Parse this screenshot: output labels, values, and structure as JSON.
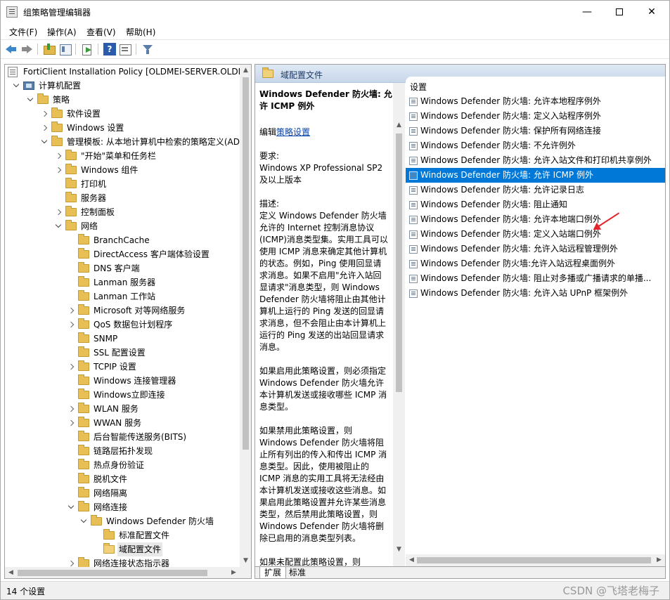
{
  "window": {
    "title": "组策略管理编辑器",
    "minimize": "—",
    "close": "✕"
  },
  "menu": [
    "文件(F)",
    "操作(A)",
    "查看(V)",
    "帮助(H)"
  ],
  "toolbar": {
    "help_glyph": "?"
  },
  "tree": [
    {
      "label": "FortiClient Installation Policy [OLDMEI-SERVER.OLDME",
      "icon": "policy-icon",
      "exp": "none",
      "level": 0
    },
    {
      "label": "计算机配置",
      "icon": "computer-icon",
      "exp": "open",
      "level": 1
    },
    {
      "label": "策略",
      "icon": "folder-icon",
      "exp": "open",
      "level": 2
    },
    {
      "label": "软件设置",
      "icon": "folder-icon",
      "exp": "closed",
      "level": 3
    },
    {
      "label": "Windows 设置",
      "icon": "folder-icon",
      "exp": "closed",
      "level": 3
    },
    {
      "label": "管理模板: 从本地计算机中检索的策略定义(ADM",
      "icon": "folder-icon",
      "exp": "open",
      "level": 3
    },
    {
      "label": "\"开始\"菜单和任务栏",
      "icon": "folder-icon",
      "exp": "closed",
      "level": 4
    },
    {
      "label": "Windows 组件",
      "icon": "folder-icon",
      "exp": "closed",
      "level": 4
    },
    {
      "label": "打印机",
      "icon": "folder-icon",
      "exp": "none",
      "level": 4
    },
    {
      "label": "服务器",
      "icon": "folder-icon",
      "exp": "none",
      "level": 4
    },
    {
      "label": "控制面板",
      "icon": "folder-icon",
      "exp": "closed",
      "level": 4
    },
    {
      "label": "网络",
      "icon": "folder-icon",
      "exp": "open",
      "level": 4
    },
    {
      "label": "BranchCache",
      "icon": "folder-icon",
      "exp": "none",
      "level": 5
    },
    {
      "label": "DirectAccess 客户端体验设置",
      "icon": "folder-icon",
      "exp": "none",
      "level": 5
    },
    {
      "label": "DNS 客户端",
      "icon": "folder-icon",
      "exp": "none",
      "level": 5
    },
    {
      "label": "Lanman 服务器",
      "icon": "folder-icon",
      "exp": "none",
      "level": 5
    },
    {
      "label": "Lanman 工作站",
      "icon": "folder-icon",
      "exp": "none",
      "level": 5
    },
    {
      "label": "Microsoft 对等网络服务",
      "icon": "folder-icon",
      "exp": "closed",
      "level": 5
    },
    {
      "label": "QoS 数据包计划程序",
      "icon": "folder-icon",
      "exp": "closed",
      "level": 5
    },
    {
      "label": "SNMP",
      "icon": "folder-icon",
      "exp": "none",
      "level": 5
    },
    {
      "label": "SSL 配置设置",
      "icon": "folder-icon",
      "exp": "none",
      "level": 5
    },
    {
      "label": "TCPIP 设置",
      "icon": "folder-icon",
      "exp": "closed",
      "level": 5
    },
    {
      "label": "Windows 连接管理器",
      "icon": "folder-icon",
      "exp": "none",
      "level": 5
    },
    {
      "label": "Windows立即连接",
      "icon": "folder-icon",
      "exp": "none",
      "level": 5
    },
    {
      "label": "WLAN 服务",
      "icon": "folder-icon",
      "exp": "closed",
      "level": 5
    },
    {
      "label": "WWAN 服务",
      "icon": "folder-icon",
      "exp": "closed",
      "level": 5
    },
    {
      "label": "后台智能传送服务(BITS)",
      "icon": "folder-icon",
      "exp": "none",
      "level": 5
    },
    {
      "label": "链路层拓扑发现",
      "icon": "folder-icon",
      "exp": "none",
      "level": 5
    },
    {
      "label": "热点身份验证",
      "icon": "folder-icon",
      "exp": "none",
      "level": 5
    },
    {
      "label": "脱机文件",
      "icon": "folder-icon",
      "exp": "none",
      "level": 5
    },
    {
      "label": "网络隔离",
      "icon": "folder-icon",
      "exp": "none",
      "level": 5
    },
    {
      "label": "网络连接",
      "icon": "folder-icon",
      "exp": "open",
      "level": 5
    },
    {
      "label": "Windows Defender 防火墙",
      "icon": "folder-icon",
      "exp": "open",
      "level": 6
    },
    {
      "label": "标准配置文件",
      "icon": "folder-icon",
      "exp": "none",
      "level": 7
    },
    {
      "label": "域配置文件",
      "icon": "folder-icon",
      "exp": "none",
      "level": 7,
      "selected": true
    },
    {
      "label": "网络连接状态指示器",
      "icon": "folder-icon",
      "exp": "closed",
      "level": 5
    }
  ],
  "mid": {
    "header": "域配置文件",
    "policy_title": "Windows Defender 防火墙: 允许 ICMP 例外",
    "edit_prefix": "编辑",
    "edit_link": "策略设置",
    "requirements_label": "要求:",
    "requirements": "Windows XP Professional SP2 及以上版本",
    "description_label": "描述:",
    "description": "定义 Windows Defender 防火墙允许的 Internet 控制消息协议(ICMP)消息类型集。实用工具可以使用 ICMP 消息来确定其他计算机的状态。例如，Ping 使用回显请求消息。如果不启用\"允许入站回显请求\"消息类型，则 Windows Defender 防火墙将阻止由其他计算机上运行的 Ping 发送的回显请求消息，但不会阻止由本计算机上运行的 Ping 发送的出站回显请求消息。",
    "para_enabled": "如果启用此策略设置，则必须指定 Windows Defender 防火墙允许本计算机发送或接收哪些 ICMP 消息类型。",
    "para_disabled": "如果禁用此策略设置，则 Windows Defender 防火墙将阻止所有列出的传入和传出 ICMP 消息类型。因此，使用被阻止的 ICMP 消息的实用工具将无法经由本计算机发送或接收这些消息。如果启用此策略设置并允许某些消息类型，然后禁用此策略设置，则 Windows Defender 防火墙将删除已启用的消息类型列表。",
    "para_notconfigured": "如果未配置此策略设置，则"
  },
  "settings": {
    "column_header": "设置",
    "rows": [
      "Windows Defender 防火墙: 允许本地程序例外",
      "Windows Defender 防火墙: 定义入站程序例外",
      "Windows Defender 防火墙: 保护所有网络连接",
      "Windows Defender 防火墙: 不允许例外",
      "Windows Defender 防火墙: 允许入站文件和打印机共享例外",
      "Windows Defender 防火墙: 允许 ICMP 例外",
      "Windows Defender 防火墙: 允许记录日志",
      "Windows Defender 防火墙: 阻止通知",
      "Windows Defender 防火墙: 允许本地端口例外",
      "Windows Defender 防火墙: 定义入站端口例外",
      "Windows Defender 防火墙: 允许入站远程管理例外",
      "Windows Defender 防火墙:允许入站远程桌面例外",
      "Windows Defender 防火墙: 阻止对多播或广播请求的单播...",
      "Windows Defender 防火墙: 允许入站 UPnP 框架例外"
    ],
    "selected_index": 5,
    "accent": "#0078d7"
  },
  "tabs": [
    "扩展",
    "标准"
  ],
  "status": {
    "text": "14 个设置",
    "watermark": "CSDN @飞塔老梅子"
  }
}
